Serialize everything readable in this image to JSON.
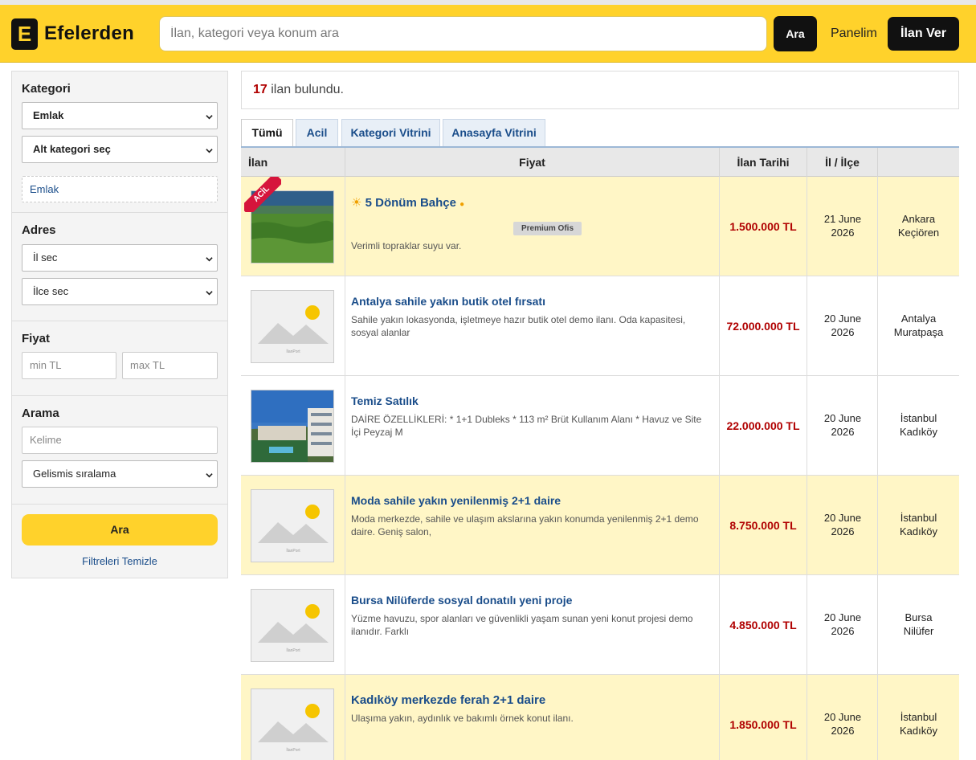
{
  "header": {
    "logo_letter": "E",
    "logo_text": "Efelerden",
    "search_placeholder": "İlan, kategori veya konum ara",
    "search_button": "Ara",
    "panel_link": "Panelim",
    "post_button": "İlan Ver"
  },
  "sidebar": {
    "category_title": "Kategori",
    "category_select": "Emlak",
    "subcategory_select": "Alt kategori seç",
    "active_chip": "Emlak",
    "address_title": "Adres",
    "province_select": "İl sec",
    "district_select": "İlce sec",
    "price_title": "Fiyat",
    "min_placeholder": "min TL",
    "max_placeholder": "max TL",
    "search_title": "Arama",
    "keyword_placeholder": "Kelime",
    "sort_select": "Gelismis sıralama",
    "search_button": "Ara",
    "clear_link": "Filtreleri Temizle"
  },
  "results": {
    "count": "17",
    "text": " ilan bulundu."
  },
  "tabs": [
    "Tümü",
    "Acil",
    "Kategori Vitrini",
    "Anasayfa Vitrini"
  ],
  "table": {
    "headers": [
      "İlan",
      "Fiyat",
      "İlan Tarihi",
      "İl / İlçe"
    ],
    "rows": [
      {
        "title": "5 Dönüm Bahçe",
        "description": "Verimli topraklar suyu var.",
        "badge": "Premium Ofis",
        "ribbon": "ACİL",
        "price": "1.500.000 TL",
        "date_line1": "21 June",
        "date_line2": "2026",
        "city": "Ankara",
        "district": "Keçiören"
      },
      {
        "title": "Antalya sahile yakın butik otel fırsatı",
        "description": "Sahile yakın lokasyonda, işletmeye hazır butik otel demo ilanı. Oda kapasitesi, sosyal alanlar",
        "price": "72.000.000 TL",
        "date_line1": "20 June",
        "date_line2": "2026",
        "city": "Antalya",
        "district": "Muratpaşa"
      },
      {
        "title": "Temiz Satılık",
        "description": "DAİRE ÖZELLİKLERİ: * 1+1 Dubleks * 113 m² Brüt Kullanım Alanı * Havuz ve Site İçi Peyzaj M",
        "price": "22.000.000 TL",
        "date_line1": "20 June",
        "date_line2": "2026",
        "city": "İstanbul",
        "district": "Kadıköy"
      },
      {
        "title": "Moda sahile yakın yenilenmiş 2+1 daire",
        "description": "Moda merkezde, sahile ve ulaşım akslarına yakın konumda yenilenmiş 2+1 demo daire. Geniş salon,",
        "price": "8.750.000 TL",
        "date_line1": "20 June",
        "date_line2": "2026",
        "city": "İstanbul",
        "district": "Kadıköy"
      },
      {
        "title": "Bursa Nilüferde sosyal donatılı yeni proje",
        "description": "Yüzme havuzu, spor alanları ve güvenlikli yaşam sunan yeni konut projesi demo ilanıdır. Farklı",
        "price": "4.850.000 TL",
        "date_line1": "20 June",
        "date_line2": "2026",
        "city": "Bursa",
        "district": "Nilüfer"
      },
      {
        "title": "Kadıköy merkezde ferah 2+1 daire",
        "description": "Ulaşıma yakın, aydınlık ve bakımlı örnek konut ilanı.",
        "price": "1.850.000 TL",
        "date_line1": "20 June",
        "date_line2": "2026",
        "city": "İstanbul",
        "district": "Kadıköy"
      }
    ]
  },
  "placeholder_caption": "İlanPort",
  "colors": {
    "brand_yellow": "#ffd22b",
    "highlight_row": "#fff6c6",
    "price_red": "#b00000",
    "link_blue": "#1a4d8a",
    "ribbon_red": "#d6153c"
  }
}
